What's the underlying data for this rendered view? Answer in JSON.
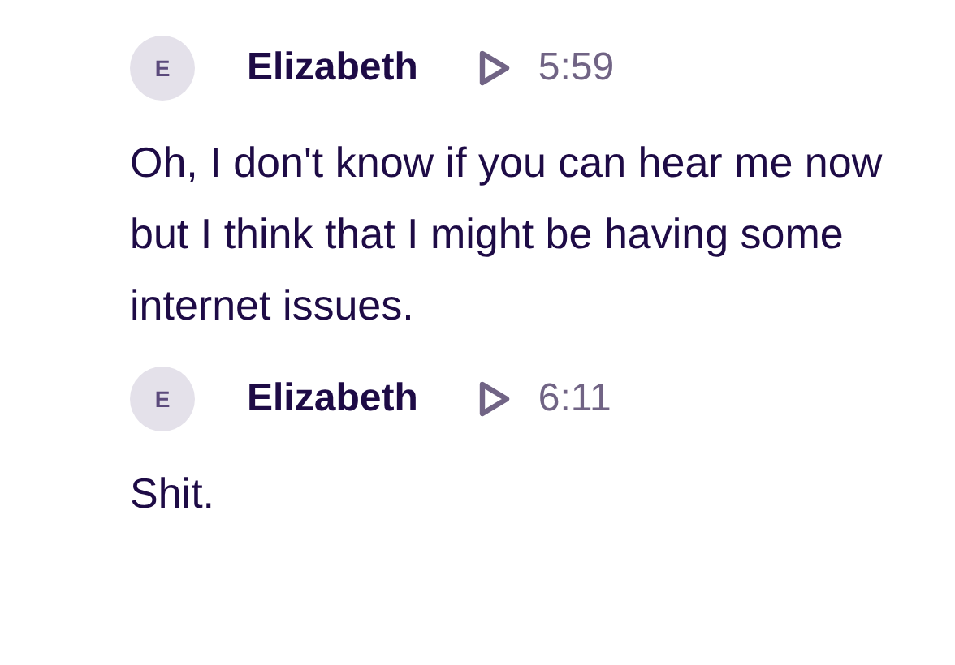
{
  "messages": [
    {
      "avatar": "E",
      "author": "Elizabeth",
      "time": "5:59",
      "text": "Oh, I don't know if you can hear me now but I think that I might be having some internet issues."
    },
    {
      "avatar": "E",
      "author": "Elizabeth",
      "time": "6:11",
      "text": "Shit."
    }
  ]
}
